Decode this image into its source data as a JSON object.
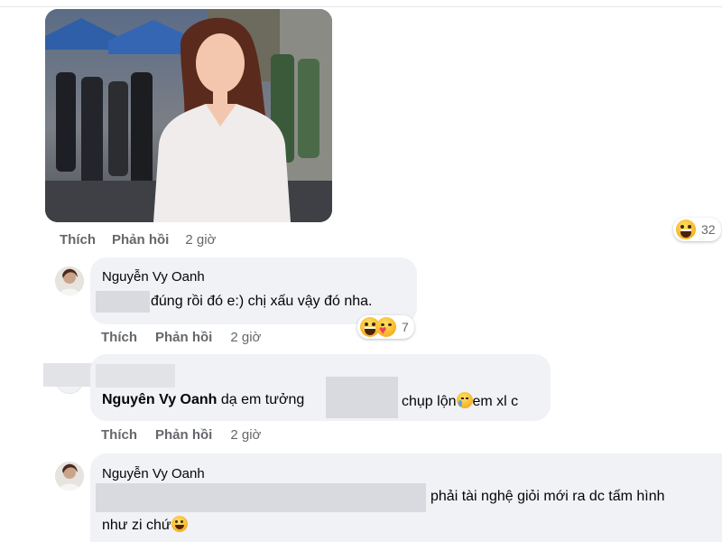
{
  "post": {
    "actions": {
      "like": "Thích",
      "reply": "Phản hồi",
      "time": "2 giờ"
    },
    "reaction_count": "32",
    "reaction_icons": [
      "haha-emoji-icon"
    ]
  },
  "comments": [
    {
      "author": "Nguyễn Vy Oanh",
      "text": "đúng rồi đó e:) chị xấu vậy đó nha.",
      "reaction_count": "7",
      "reaction_icons": [
        "haha-emoji-icon",
        "care-emoji-icon"
      ],
      "actions": {
        "like": "Thích",
        "reply": "Phản hồi",
        "time": "2 giờ"
      }
    },
    {
      "tagged_name": "Nguyên Vy Oanh",
      "text_a": "dạ em tưởng",
      "text_b": "chụp lộn",
      "text_c": "em xl c",
      "inline_icon": "crying-face-icon",
      "actions": {
        "like": "Thích",
        "reply": "Phản hồi",
        "time": "2 giờ"
      }
    },
    {
      "author": "Nguyễn Vy Oanh",
      "line1": "phải tài nghệ giỏi mới ra dc tấm hình",
      "line2": "như zi chứ",
      "inline_icon": "grinning-face-icon"
    }
  ]
}
